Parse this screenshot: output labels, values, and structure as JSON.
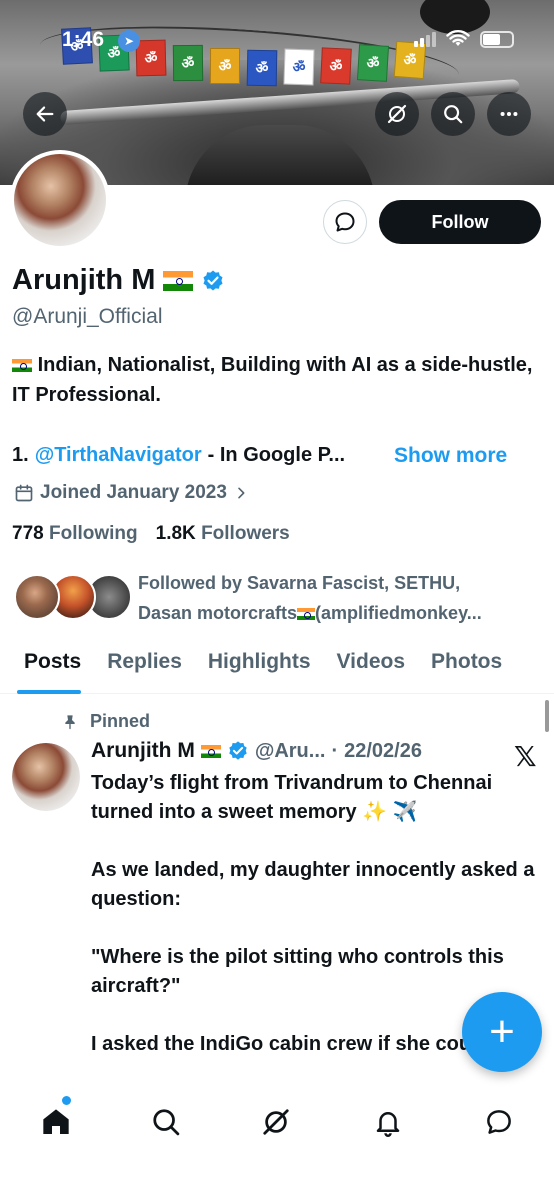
{
  "status_bar": {
    "time": "1:46"
  },
  "banner": {
    "flags": [
      {
        "glyph": "ॐ",
        "color": "#2e4fb0"
      },
      {
        "glyph": "ॐ",
        "color": "#1c9a5a"
      },
      {
        "glyph": "ॐ",
        "color": "#d6372b"
      },
      {
        "glyph": "ॐ",
        "color": "#2c8f3f"
      },
      {
        "glyph": "ॐ",
        "color": "#e5a51d"
      },
      {
        "glyph": "ॐ",
        "color": "#2a57c2"
      },
      {
        "glyph": "ॐ",
        "color": "#ffffff"
      },
      {
        "glyph": "ॐ",
        "color": "#d93a2c"
      },
      {
        "glyph": "ॐ",
        "color": "#2d9a49"
      },
      {
        "glyph": "ॐ",
        "color": "#e3b21e"
      }
    ]
  },
  "header": {
    "back_icon": "arrow-left-icon",
    "grok_icon": "grok-icon",
    "search_icon": "search-icon",
    "more_icon": "more-horizontal-icon"
  },
  "profile": {
    "name": "Arunjith M",
    "handle": "@Arunji_Official",
    "follow_label": "Follow",
    "bio_line1": "Indian, Nationalist, Building with AI as a side-hustle, IT Professional.",
    "bio_item_number": "1.",
    "bio_mention": "@TirthaNavigator",
    "bio_rest": "- In Google P...",
    "show_more": "Show more",
    "joined": "Joined January 2023",
    "following_count": "778",
    "following_label": "Following",
    "followers_count": "1.8K",
    "followers_label": "Followers",
    "followed_by_line1": "Followed by Savarna Fascist, SETHU,",
    "followed_by_line2a": "Dasan motorcrafts",
    "followed_by_line2b": "(amplifiedmonkey..."
  },
  "tabs": [
    "Posts",
    "Replies",
    "Highlights",
    "Videos",
    "Photos"
  ],
  "active_tab": "Posts",
  "pinned_post": {
    "pinned_label": "Pinned",
    "author": "Arunjith M",
    "handle": "@Aru...",
    "separator": "·",
    "date": "22/02/26",
    "text": "Today’s flight from Trivandrum to Chennai turned into a sweet memory ✨ ✈️\n\nAs we landed, my daughter innocently asked a question:\n\n\"Where is the pilot sitting who controls this aircraft?\"\n\nI asked the IndiGo cabin crew if she could"
  },
  "fab": {
    "label": "+"
  },
  "bottom_nav": [
    "home-icon",
    "search-icon",
    "grok-icon",
    "notifications-icon",
    "messages-icon"
  ],
  "colors": {
    "accent": "#1d9bf0",
    "text": "#0f1419",
    "muted": "#536471",
    "follow_bg": "#0f1419"
  }
}
